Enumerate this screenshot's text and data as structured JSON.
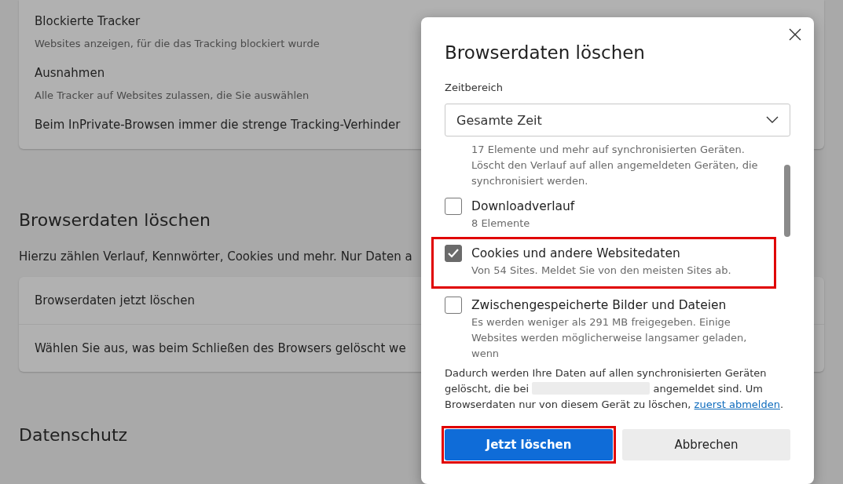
{
  "settings": {
    "tracking_card": [
      {
        "title": "Blockierte Tracker",
        "description": "Websites anzeigen, für die das Tracking blockiert wurde"
      },
      {
        "title": "Ausnahmen",
        "description": "Alle Tracker auf Websites zulassen, die Sie auswählen"
      },
      {
        "title": "Beim InPrivate-Browsen immer die strenge Tracking-Verhinder"
      }
    ],
    "clear_section": {
      "heading": "Browserdaten löschen",
      "description": "Hierzu zählen Verlauf, Kennwörter, Cookies und mehr. Nur Daten a",
      "rows": [
        "Browserdaten jetzt löschen",
        "Wählen Sie aus, was beim Schließen des Browsers gelöscht we"
      ]
    },
    "next_heading": "Datenschutz"
  },
  "dialog": {
    "title": "Browserdaten löschen",
    "time_range_label": "Zeitbereich",
    "time_range": "Gesamte Zeit",
    "items": [
      {
        "kind": "continuation",
        "description": "17 Elemente und mehr auf synchronisierten Geräten. Löscht den Verlauf auf allen angemeldeten Geräten, die synchronisiert werden."
      },
      {
        "kind": "checkbox",
        "title": "Downloadverlauf",
        "description": "8 Elemente",
        "checked": false,
        "highlight": false
      },
      {
        "kind": "checkbox",
        "title": "Cookies und andere Websitedaten",
        "description": "Von 54 Sites. Meldet Sie von den meisten Sites ab.",
        "checked": true,
        "highlight": true
      },
      {
        "kind": "checkbox",
        "title": "Zwischengespeicherte Bilder und Dateien",
        "description": "Es werden weniger als 291 MB freigegeben. Einige Websites werden möglicherweise langsamer geladen, wenn",
        "checked": false,
        "highlight": false
      }
    ],
    "notice": {
      "before": "Dadurch werden Ihre Daten auf allen synchronisierten Geräten gelöscht, die bei",
      "after": "angemeldet sind. Um Browserdaten nur von diesem Gerät zu löschen,",
      "link": "zuerst abmelden",
      "end": "."
    },
    "buttons": [
      {
        "label": "Jetzt löschen",
        "kind": "primary",
        "highlight": true
      },
      {
        "label": "Abbrechen",
        "kind": "secondary",
        "highlight": false
      }
    ]
  }
}
